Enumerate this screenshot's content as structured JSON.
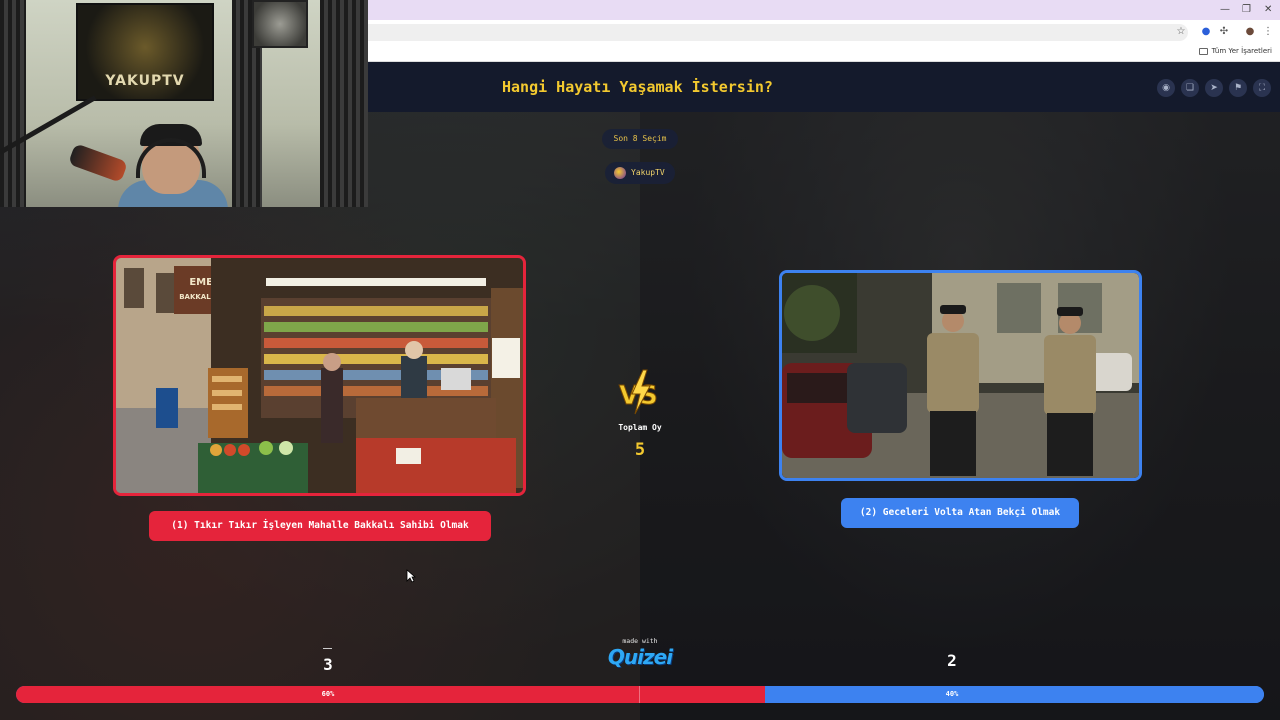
{
  "browser": {
    "bookmarks_label": "Tüm Yer İşaretleri",
    "window_controls": [
      "—",
      "❐",
      "✕"
    ]
  },
  "page": {
    "title": "Hangi Hayatı Yaşamak İstersin?",
    "last_choices": "Son 8 Seçim",
    "username": "YakupTV",
    "header_icons": [
      "eye-icon",
      "copy-icon",
      "send-icon",
      "flag-icon",
      "fullscreen-icon"
    ]
  },
  "webcam": {
    "poster_text": "YAKUPTV"
  },
  "options": {
    "left": {
      "label": "(1) Tıkır Tıkır İşleyen Mahalle Bakkalı Sahibi Olmak",
      "votes": "3",
      "percent": "60%",
      "sign_text": "EMEK BAKKALİYESİ"
    },
    "right": {
      "label": "(2) Geceleri Volta Atan Bekçi Olmak",
      "votes": "2",
      "percent": "40%"
    }
  },
  "totals": {
    "label": "Toplam Oy",
    "value": "5"
  },
  "vote_share": {
    "left": 0.6,
    "right": 0.4
  },
  "branding": {
    "made_with": "made with",
    "logo": "Quizei"
  },
  "colors": {
    "accent": "#f3c92f",
    "red": "#e5243b",
    "blue": "#3d82f0"
  }
}
